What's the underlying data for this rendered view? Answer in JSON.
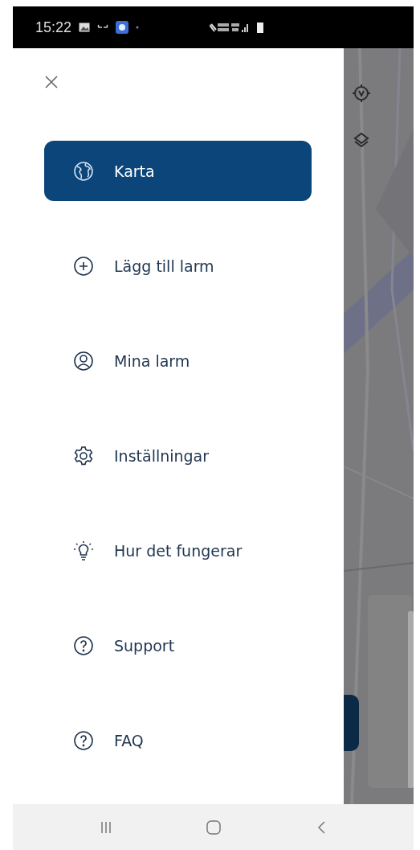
{
  "status_bar": {
    "time": "15:22"
  },
  "menu": [
    {
      "label": "Karta",
      "kind": "globe",
      "selected": true
    },
    {
      "label": "Lägg till larm",
      "kind": "add",
      "selected": false
    },
    {
      "label": "Mina larm",
      "kind": "user",
      "selected": false
    },
    {
      "label": "Inställningar",
      "kind": "settings",
      "selected": false
    },
    {
      "label": "Hur det fungerar",
      "kind": "bulb",
      "selected": false
    },
    {
      "label": "Support",
      "kind": "help",
      "selected": false
    },
    {
      "label": "FAQ",
      "kind": "help",
      "selected": false
    }
  ]
}
